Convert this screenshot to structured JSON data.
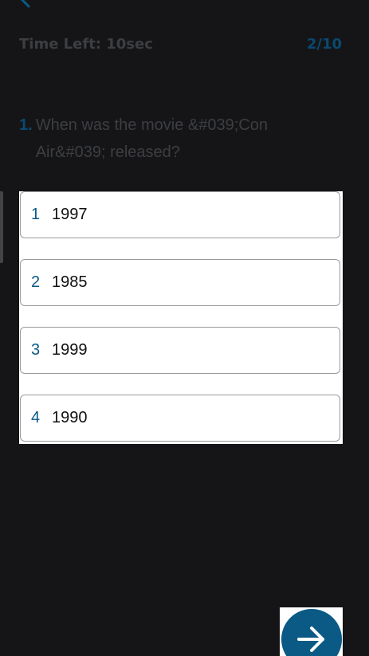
{
  "header": {
    "back_icon": "chevron-left-icon",
    "timer_text": "Time Left: 10sec",
    "progress_text": "2/10"
  },
  "question": {
    "number": "1.",
    "text": "When was the movie &#039;Con Air&#039; released?"
  },
  "options": [
    {
      "index": "1",
      "label": "1997"
    },
    {
      "index": "2",
      "label": "1985"
    },
    {
      "index": "3",
      "label": "1999"
    },
    {
      "index": "4",
      "label": "1990"
    }
  ],
  "next_button": {
    "icon": "arrow-right-icon"
  },
  "colors": {
    "background": "#151517",
    "accent": "#0a5a85",
    "muted_text": "#3c3e42"
  }
}
